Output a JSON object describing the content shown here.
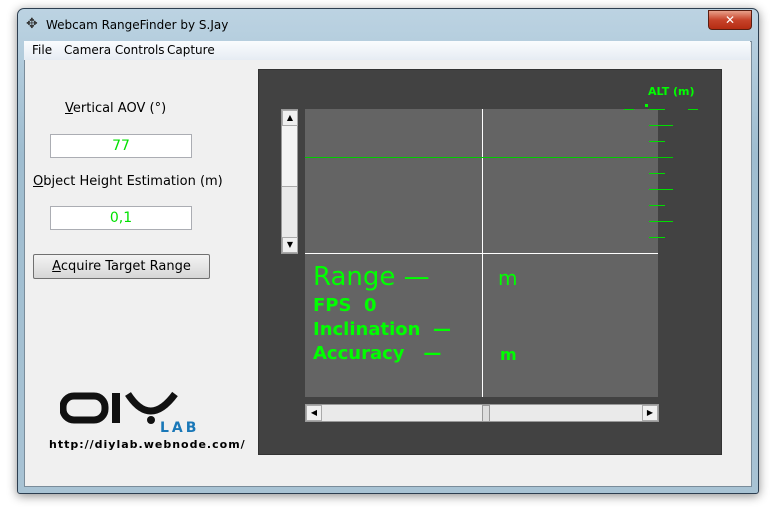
{
  "window": {
    "title": "Webcam RangeFinder by S.Jay",
    "close_icon": "close-icon",
    "move_icon": "move-icon"
  },
  "menu": [
    "File",
    "Camera Controls",
    "Capture"
  ],
  "form": {
    "aov_label_u": "V",
    "aov_label": "ertical AOV (°)",
    "aov_value": "77",
    "height_label_u": "O",
    "height_label": "bject Height Estimation (m)",
    "height_value": "0,1",
    "acquire_u": "A",
    "acquire": "cquire Target Range"
  },
  "logo": {
    "text": "DIY LAB",
    "url": "http://diylab.webnode.com/"
  },
  "overlay": {
    "alt_label": "ALT (m)",
    "range_label": "Range",
    "range_value": "—",
    "range_unit": "m",
    "fps_label": "FPS",
    "fps_value": "0",
    "inclination_label": "Inclination",
    "inclination_value": "—",
    "accuracy_label": "Accuracy",
    "accuracy_value": "—",
    "accuracy_unit": "m"
  },
  "colors": {
    "hud": "#00ff00",
    "video": "#646464",
    "panel": "#424242"
  }
}
